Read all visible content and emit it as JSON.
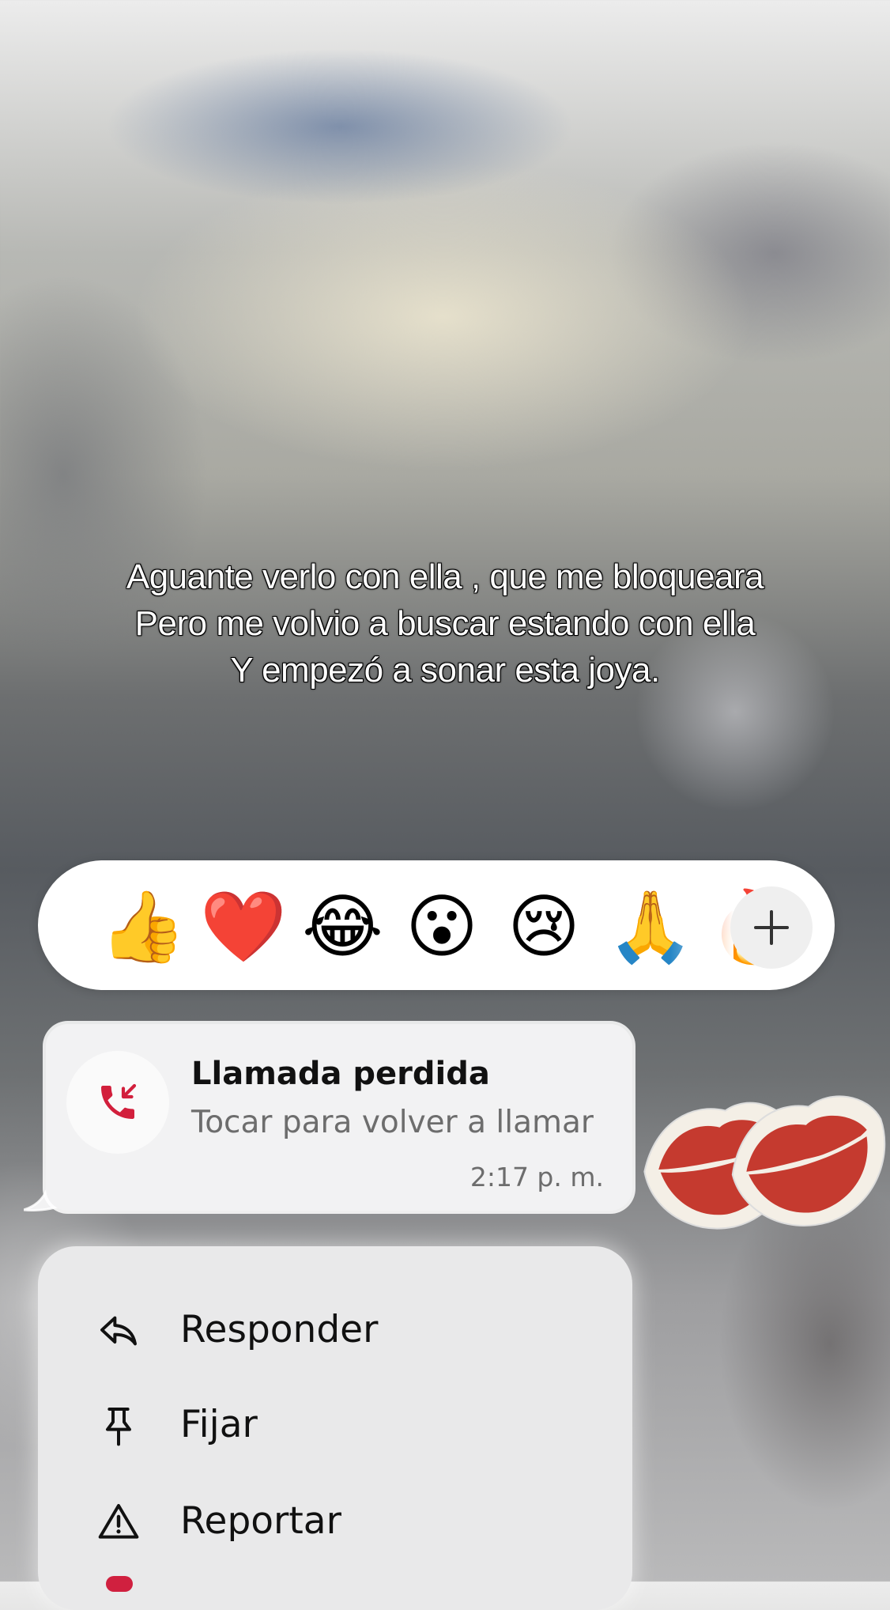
{
  "caption": {
    "lines": [
      "Aguante verlo con ella , que me bloqueara",
      "Pero me volvio a buscar estando con ella",
      "Y empezó a sonar esta joya."
    ]
  },
  "reactions": {
    "emojis": [
      {
        "name": "thumbs-up",
        "glyph": "👍"
      },
      {
        "name": "red-heart",
        "glyph": "❤️"
      },
      {
        "name": "tears-of-joy",
        "glyph": "😂"
      },
      {
        "name": "surprised",
        "glyph": "😮"
      },
      {
        "name": "crying",
        "glyph": "😢"
      },
      {
        "name": "folded-hands",
        "glyph": "🙏"
      },
      {
        "name": "fire",
        "glyph": "🔥"
      }
    ],
    "more_label": "+"
  },
  "message": {
    "title": "Llamada perdida",
    "subtitle": "Tocar para volver a llamar",
    "time": "2:17 p. m.",
    "icon": "missed-call-icon",
    "icon_color": "#d21f3c"
  },
  "menu": {
    "items": [
      {
        "label": "Responder",
        "icon": "reply-icon"
      },
      {
        "label": "Fijar",
        "icon": "pin-icon"
      },
      {
        "label": "Reportar",
        "icon": "report-icon"
      }
    ]
  },
  "colors": {
    "accent_red": "#d21f3c",
    "bubble_bg": "#f2f2f3",
    "menu_bg": "#e9e9ea"
  }
}
